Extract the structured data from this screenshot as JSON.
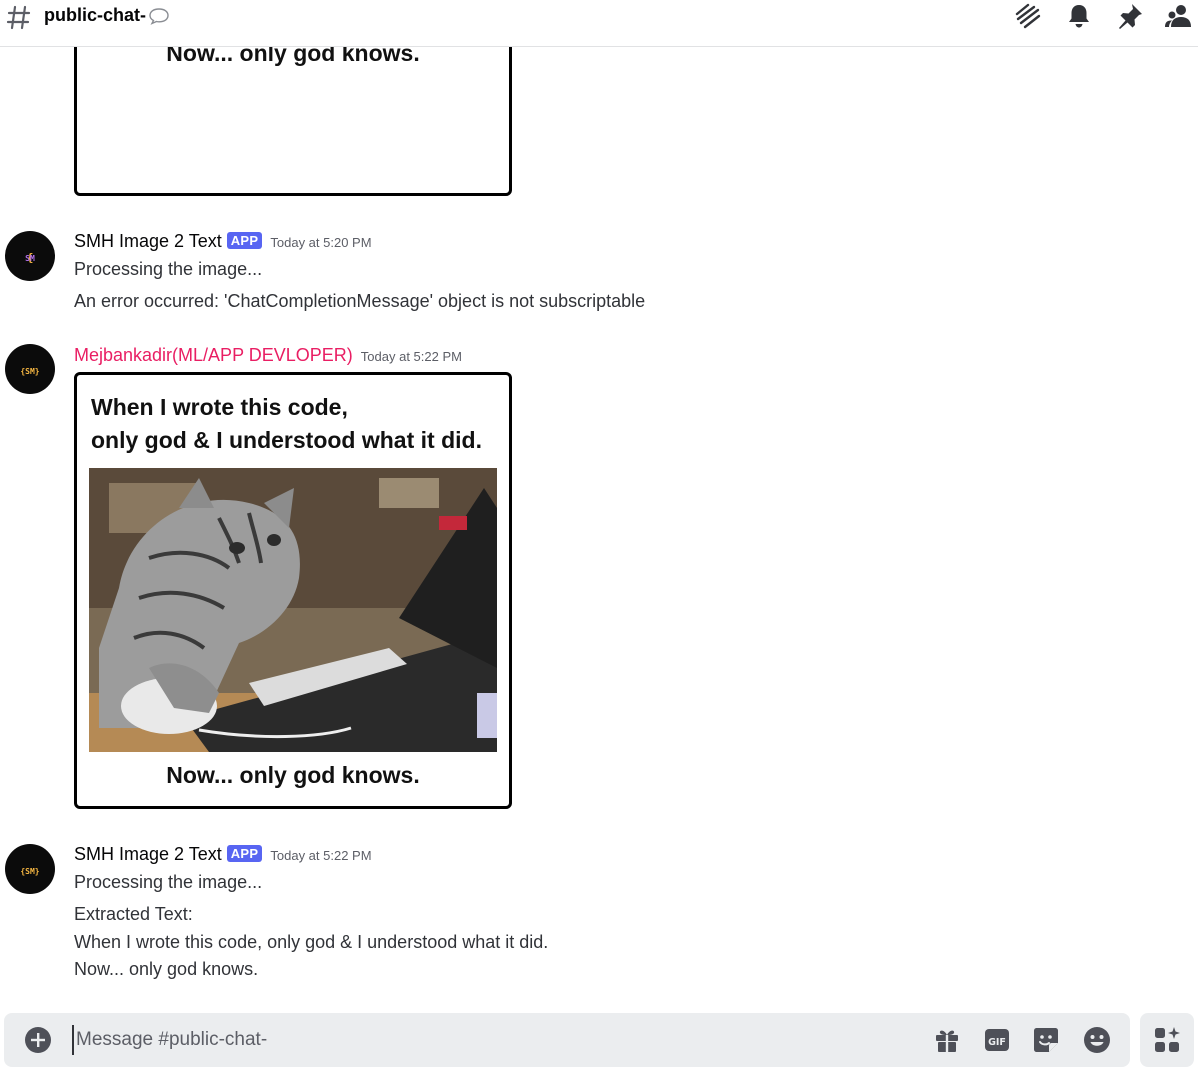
{
  "header": {
    "channel_name": "public-chat-",
    "icons": [
      "hash-icon",
      "chat-bubble-icon",
      "threads-icon",
      "bell-icon",
      "pin-icon",
      "members-icon"
    ]
  },
  "meme": {
    "top_text_line1": "When I wrote this code,",
    "top_text_line2": "only god & I understood what it did.",
    "bottom_text": "Now... only god knows."
  },
  "messages": [
    {
      "author": "SMH Image 2 Text",
      "badge": "APP",
      "timestamp": "Today at 5:20 PM",
      "lines": [
        "Processing the image...",
        "An error occurred: 'ChatCompletionMessage' object is not subscriptable"
      ]
    },
    {
      "author": "Mejbankadir(ML/APP DEVLOPER)",
      "timestamp": "Today at 5:22 PM",
      "author_color": "#e91e63"
    },
    {
      "author": "SMH Image 2 Text",
      "badge": "APP",
      "timestamp": "Today at 5:22 PM",
      "lines": [
        "Processing the image...",
        "Extracted Text:",
        "When I wrote this code, only god & I understood what it did.",
        "Now... only god knows."
      ]
    }
  ],
  "composer": {
    "placeholder": "Message #public-chat-",
    "icons": [
      "plus-icon",
      "gift-icon",
      "gif-icon",
      "sticker-icon",
      "emoji-icon",
      "apps-icon"
    ]
  },
  "colors": {
    "accent": "#5865f2",
    "username_red": "#e91e63"
  }
}
